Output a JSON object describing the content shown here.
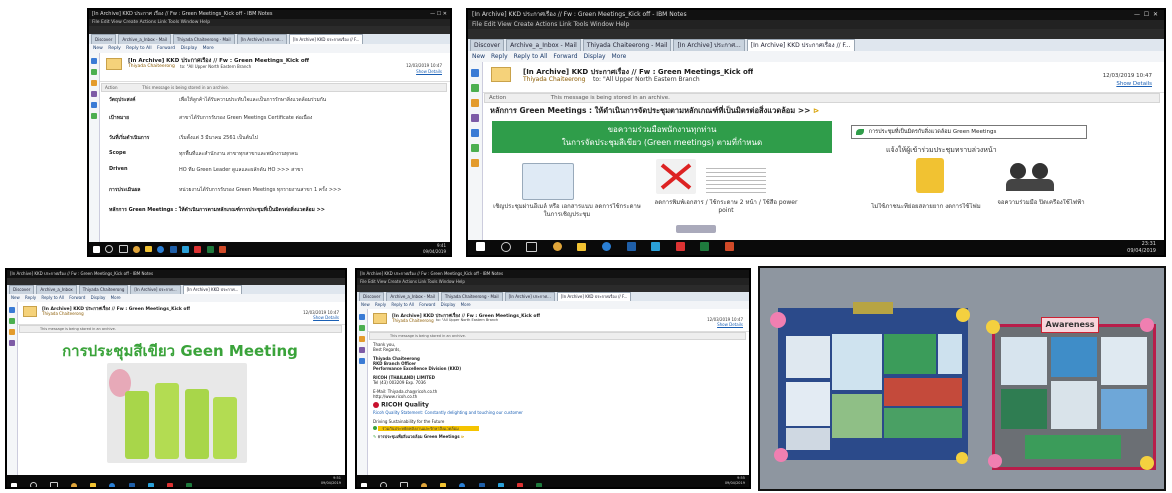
{
  "screenshot1": {
    "window_title": "[In Archive] KKD ประกาศ เรื่อง // Fw : Green Meetings_Kick off - IBM Notes",
    "menu": "File  Edit  View  Create  Actions  Link  Tools  Window  Help",
    "tabs": [
      "Discover",
      "Archive_a_Inbox - Mail",
      "Thiyada Chaiteerong - Mail",
      "[In Archive] ประกาศ...",
      "[In Archive] KKD ประกาศเรื่อง // F..."
    ],
    "toolbar": [
      "New",
      "Reply",
      "Reply to All",
      "Forward",
      "Display",
      "More"
    ],
    "subject": "[In Archive] KKD ประกาศเรื่อง // Fw : Green Meetings_Kick off",
    "sender": "Thiyada Chaiteerong",
    "to": "to: \"All Upper North Eastern Branch",
    "date": "12/03/2019 10:47",
    "show_details": "Show Details",
    "notice_label": "Action",
    "notice": "This message is being stored in an archive.",
    "fields": [
      {
        "label": "วัตถุประสงค์",
        "value": "เพื่อให้ลูกค้าได้รับความประทับใจและเป็นการรักษาสิ่งแวดล้อมร่วมกัน"
      },
      {
        "label": "เป้าหมาย",
        "value": "สาขาได้รับการรับรอง Green Meetings Certificate ต่อเนื่อง"
      },
      {
        "label": "วันที่เริ่มดำเนินการ",
        "value": "เริ่มตั้งแต่ 3 มีนาคม 2561 เป็นต้นไป"
      },
      {
        "label": "Scope",
        "value": "ทุกพื้นที่และสำนักงาน สาขาทุกสาขาและพนักงานทุกคน"
      },
      {
        "label": "Driven",
        "value": "HO ทีม Green Leader ดูแลและผลักดัน HO >>> สาขา"
      },
      {
        "label": "การประเมินผล",
        "value": "หน่วยงานได้รับการรับรอง Green Meetings ทุกรายงานสาขา 1 ครั้ง >>>"
      }
    ],
    "footer_line": "หลักการ Green Meetings : ให้ดำเนินการตามหลักเกณฑ์การประชุมที่เป็นมิตรต่อสิ่งแวดล้อม >>",
    "tray_time": "9:41",
    "tray_date": "09/04/2019"
  },
  "screenshot2": {
    "window_title": "[In Archive] KKD ประกาศเรื่อง // Fw : Green Meetings_Kick off - IBM Notes",
    "menu": "File  Edit  View  Create  Actions  Link  Tools  Window  Help",
    "tabs": [
      "Discover",
      "Archive_a_Inbox - Mail",
      "Thiyada Chaiteerong - Mail",
      "[In Archive] ประกาศ...",
      "[In Archive] KKD ประกาศเรื่อง // F..."
    ],
    "toolbar": [
      "New",
      "Reply",
      "Reply to All",
      "Forward",
      "Display",
      "More"
    ],
    "subject": "[In Archive] KKD ประกาศเรื่อง // Fw : Green Meetings_Kick off",
    "sender": "Thiyada Chaiteerong",
    "to": "to: \"All Upper North Eastern Branch",
    "date": "12/03/2019 10:47",
    "show_details": "Show Details",
    "notice_label": "Action",
    "notice": "This message is being stored in an archive.",
    "headline": "หลักการ Green Meetings : ให้ดำเนินการจัดประชุมตามหลักเกณฑ์ที่เป็นมิตรต่อสิ่งแวดล้อม >>",
    "banner_line1": "ขอความร่วมมือพนักงานทุกท่าน",
    "banner_line2": "ในการจัดประชุมสีเขียว (Green meetings) ตามที่กำหนด",
    "right_header": "การประชุมที่เป็นมิตรกับสิ่งแวดล้อม Green Meetings",
    "right_sub": "แจ้งให้ผู้เข้าร่วมประชุมทราบล่วงหน้า",
    "captions": [
      "เชิญประชุมผ่านอีเมล์ หรือ เอกสารแนบ ลดการใช้กระดาษในการเชิญประชุม",
      "ลดการพิมพ์เอกสาร / ใช้กระดาษ 2 หน้า / ใช้สื่อ power point",
      "ไม่ใช้ภาชนะที่ย่อยสลายยาก งดการใช้โฟม",
      "จอความร่วมมือ ปิดเครื่องใช้ไฟฟ้า"
    ],
    "tray_time": "23:31",
    "tray_date": "09/04/2019"
  },
  "screenshot3": {
    "window_title": "[In Archive] KKD ประกาศเรื่อง // Fw : Green Meetings_Kick off - IBM Notes",
    "tabs": [
      "Discover",
      "Archive_a_Inbox",
      "Thiyada Chaiteerong",
      "[In Archive] ประกาศ...",
      "[In Archive] KKD ประกาศ..."
    ],
    "toolbar": [
      "New",
      "Reply",
      "Reply to All",
      "Forward",
      "Display",
      "More"
    ],
    "subject": "[In Archive] KKD ประกาศเรื่อง // Fw : Green Meetings_Kick off",
    "sender": "Thiyada Chaiteerong",
    "date": "12/03/2019 10:47",
    "show_details": "Show Details",
    "notice": "This message is being stored in an archive.",
    "heading": "การประชุมสีเขียว Geen Meeting",
    "tray_time": "9:51",
    "tray_date": "09/04/2019"
  },
  "screenshot4": {
    "window_title": "[In Archive] KKD ประกาศเรื่อง // Fw : Green Meetings_Kick off - IBM Notes",
    "menu": "File  Edit  View  Create  Actions  Link  Tools  Window  Help",
    "tabs": [
      "Discover",
      "Archive_a_Inbox - Mail",
      "Thiyada Chaiteerong - Mail",
      "[In Archive] ประกาศ...",
      "[In Archive] KKD ประกาศเรื่อง // F..."
    ],
    "toolbar": [
      "New",
      "Reply",
      "Reply to All",
      "Forward",
      "Display",
      "More"
    ],
    "subject": "[In Archive] KKD ประกาศเรื่อง // Fw : Green Meetings_Kick off",
    "sender": "Thiyada Chaiteerong",
    "to": "to: \"All Upper North Eastern Branch",
    "date": "12/03/2019 10:47",
    "show_details": "Show Details",
    "notice": "This message is being stored in an archive.",
    "signature": [
      "Thank you,",
      "Best Regards,",
      "",
      "Thiyada Chaiteerong",
      "RKD Branch Officer",
      "Performance Excellence Division (KKD)",
      "",
      "RICOH (THAILAND) LIMITED",
      "Tel (43) 003209 Exp. 7036",
      "",
      "E-Mail: Thiyada.cha@ricoh.co.th",
      "http://www.ricoh.co.th"
    ],
    "company": "RICOH Quality",
    "quality_statement": "Ricoh Quality Statement: Constantly delighting and touching our customer",
    "driving": "Driving Sustainability for the Future",
    "highlight": "ร่วมกันประหยัดพลังงานและรักษาสิ่งแวดล้อม",
    "green_link": "การประชุมเพื่อสิ่งแวดล้อม Green Meetings",
    "tray_time": "9:55",
    "tray_date": "09/04/2019"
  },
  "screenshot5": {
    "board_label": "Awareness"
  }
}
